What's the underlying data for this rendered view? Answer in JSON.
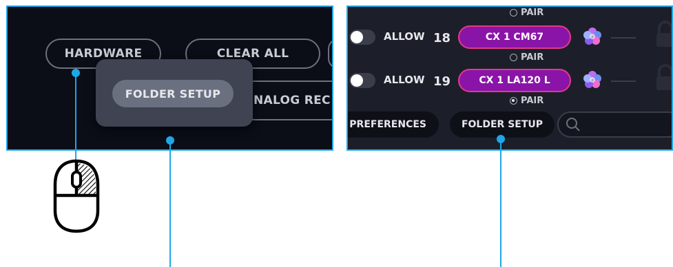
{
  "left_panel": {
    "hardware_label": "HARDWARE",
    "clear_all_label": "CLEAR ALL",
    "analog_label": "NALOG REC",
    "tooltip_label": "FOLDER SETUP"
  },
  "right_panel": {
    "pair_label": "PAIR",
    "allow_label": "ALLOW",
    "rows": [
      {
        "channel": "18",
        "device": "CX 1  CM67"
      },
      {
        "channel": "19",
        "device": "CX 1 LA120 L"
      }
    ],
    "user_prefs_label": "R PREFERENCES",
    "folder_setup_label": "FOLDER SETUP"
  },
  "colors": {
    "accent": "#1ea7e8",
    "device_pill": "#8a14a8",
    "device_pill_border": "#e23a8a",
    "left_bg": "#0b0d17",
    "right_bg": "#1c1f29"
  },
  "icons": [
    "mouse-icon",
    "flower-icon",
    "lock-icon",
    "search-icon",
    "radio-icon"
  ]
}
